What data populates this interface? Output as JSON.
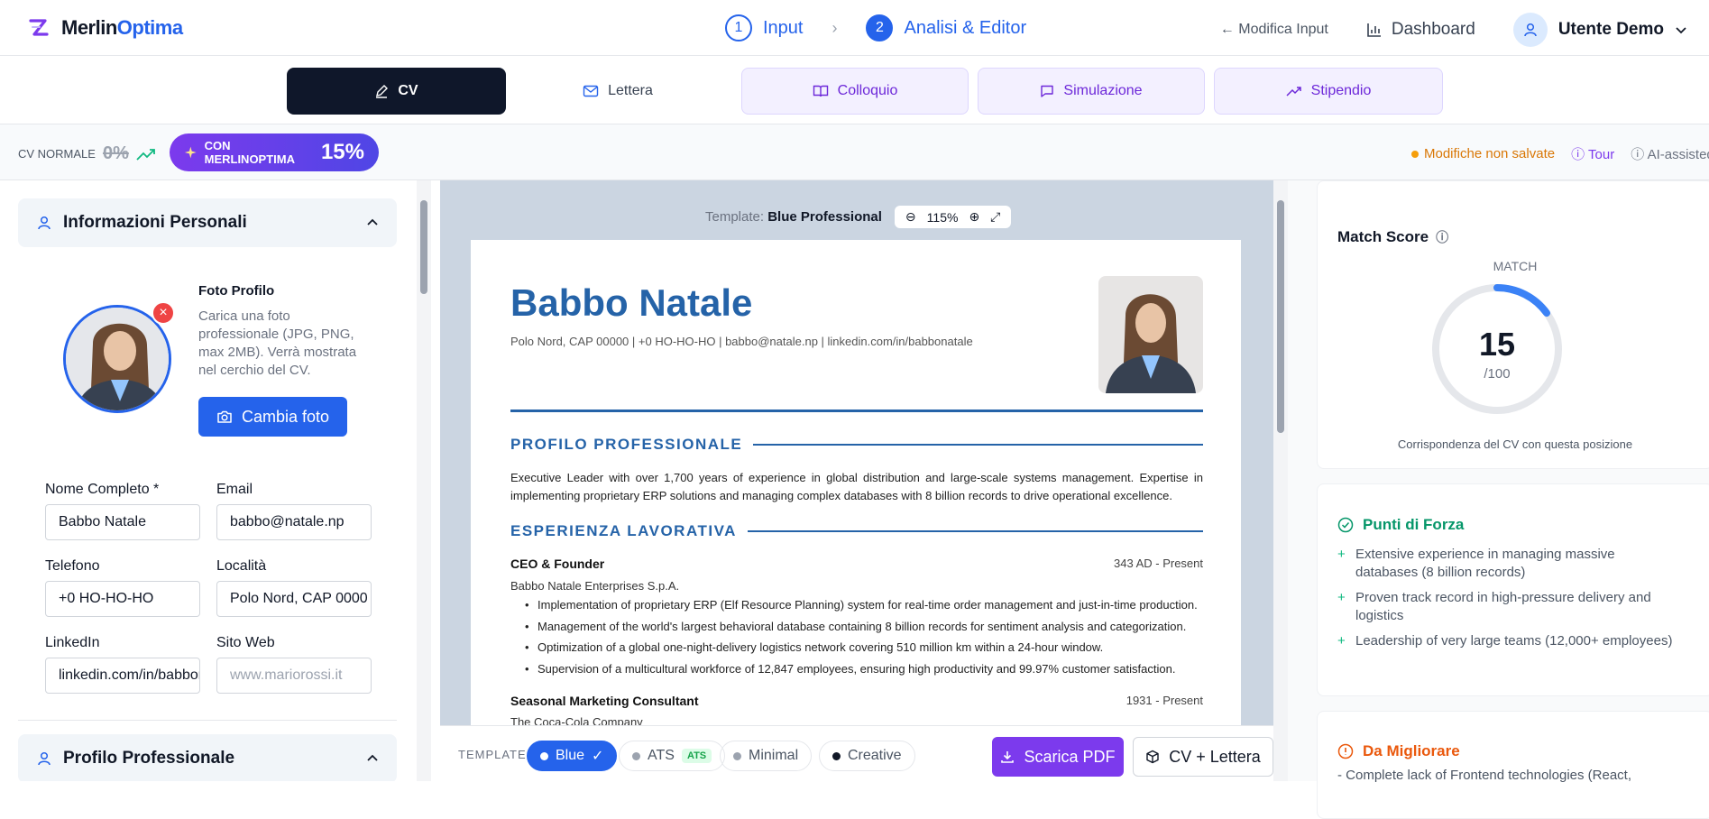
{
  "app": {
    "brand_a": "Merlin",
    "brand_b": "Optima"
  },
  "steps": [
    {
      "num": "1",
      "label": "Input"
    },
    {
      "num": "2",
      "label": "Analisi & Editor"
    }
  ],
  "header": {
    "modify_input": "← Modifica Input",
    "dashboard": "Dashboard",
    "user": "Utente Demo"
  },
  "tabs": {
    "cv": "CV",
    "letter": "Lettera",
    "interview": "Colloquio",
    "simulation": "Simulazione",
    "salary": "Stipendio"
  },
  "scorebar": {
    "normal_label": "CV NORMALE",
    "normal_pct": "0%",
    "merlin_label": "CON MERLINOPTIMA",
    "merlin_pct": "15%",
    "unsaved": "Modifiche non salvate",
    "tour": "Tour",
    "ai": "AI-assisted"
  },
  "left": {
    "personal_title": "Informazioni Personali",
    "photo_title": "Foto Profilo",
    "photo_desc": "Carica una foto professionale (JPG, PNG, max 2MB). Verrà mostrata nel cerchio del CV.",
    "change_photo": "Cambia foto",
    "fields": {
      "name_label": "Nome Completo *",
      "name_value": "Babbo Natale",
      "email_label": "Email",
      "email_value": "babbo@natale.np",
      "phone_label": "Telefono",
      "phone_value": "+0 HO-HO-HO",
      "loc_label": "Località",
      "loc_value": "Polo Nord, CAP 0000",
      "linkedin_label": "LinkedIn",
      "linkedin_value": "linkedin.com/in/babbonatale",
      "web_label": "Sito Web",
      "web_placeholder": "www.mariorossi.it"
    },
    "profile_title": "Profilo Professionale"
  },
  "preview": {
    "template_label": "Template:",
    "template_name": "Blue Professional",
    "zoom": "115%",
    "name": "Babbo Natale",
    "contact": "Polo Nord, CAP 00000 | +0 HO-HO-HO | babbo@natale.np | linkedin.com/in/babbonatale",
    "profile_heading": "PROFILO PROFESSIONALE",
    "profile_text": "Executive Leader with over 1,700 years of experience in global distribution and large-scale systems management. Expertise in implementing proprietary ERP solutions and managing complex databases with 8 billion records to drive operational excellence.",
    "exp_heading": "ESPERIENZA LAVORATIVA",
    "jobs": [
      {
        "title": "CEO & Founder",
        "dates": "343 AD - Present",
        "company": "Babbo Natale Enterprises S.p.A.",
        "bullets": [
          "Implementation of proprietary ERP (Elf Resource Planning) system for real-time order management and just-in-time production.",
          "Management of the world's largest behavioral database containing 8 billion records for sentiment analysis and categorization.",
          "Optimization of a global one-night-delivery logistics network covering 510 million km within a 24-hour window.",
          "Supervision of a multicultural workforce of 12,847 employees, ensuring high productivity and 99.97% customer satisfaction."
        ]
      },
      {
        "title": "Seasonal Marketing Consultant",
        "dates": "1931 - Present",
        "company": "The Coca-Cola Company"
      }
    ]
  },
  "bottombar": {
    "template_label": "TEMPLATE",
    "templates": [
      "Blue",
      "ATS",
      "Minimal",
      "Creative"
    ],
    "ats_badge": "ATS",
    "download": "Scarica PDF",
    "cv_letter": "CV + Lettera"
  },
  "right": {
    "match_title": "Match Score",
    "match_label": "MATCH",
    "score": "15",
    "max": "/100",
    "score_value": 15,
    "caption": "Corrispondenza del CV con questa posizione",
    "strengths_title": "Punti di Forza",
    "strengths": [
      "Extensive experience in managing massive databases (8 billion records)",
      "Proven track record in high-pressure delivery and logistics",
      "Leadership of very large teams (12,000+ employees)"
    ],
    "improve_title": "Da Migliorare",
    "improve_first": "Complete lack of Frontend technologies (React,"
  },
  "colors": {
    "primary": "#2563eb",
    "purple": "#7c3aed",
    "cv_blue": "#2563a8",
    "success": "#059669",
    "warning": "#ea580c"
  }
}
